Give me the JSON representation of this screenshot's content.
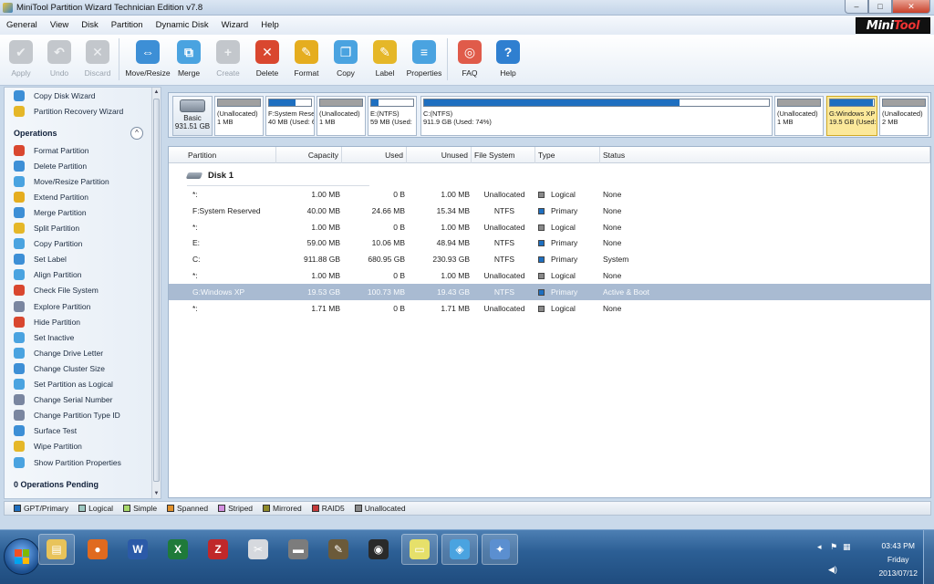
{
  "window": {
    "title": "MiniTool Partition Wizard Technician Edition v7.8",
    "logo_a": "Mini",
    "logo_b": "Tool",
    "min": "–",
    "max": "□",
    "close": "✕"
  },
  "menu": [
    "General",
    "View",
    "Disk",
    "Partition",
    "Dynamic Disk",
    "Wizard",
    "Help"
  ],
  "toolbar": [
    {
      "label": "Apply",
      "icon": "checkmark-icon",
      "enabled": false,
      "color": "#b4b9bf",
      "glyph": "✔"
    },
    {
      "label": "Undo",
      "icon": "undo-icon",
      "enabled": false,
      "color": "#b4b9bf",
      "glyph": "↶"
    },
    {
      "label": "Discard",
      "icon": "discard-icon",
      "enabled": false,
      "color": "#b4b9bf",
      "glyph": "✕"
    },
    {
      "label": "Move/Resize",
      "icon": "move-resize-icon",
      "enabled": true,
      "color": "#3d8fd6",
      "glyph": "⇔"
    },
    {
      "label": "Merge",
      "icon": "merge-icon",
      "enabled": true,
      "color": "#4aa3e0",
      "glyph": "⧉"
    },
    {
      "label": "Create",
      "icon": "create-icon",
      "enabled": false,
      "color": "#b4b9bf",
      "glyph": "+"
    },
    {
      "label": "Delete",
      "icon": "delete-icon",
      "enabled": true,
      "color": "#d9472f",
      "glyph": "✕"
    },
    {
      "label": "Format",
      "icon": "format-icon",
      "enabled": true,
      "color": "#e5ad1f",
      "glyph": "✎"
    },
    {
      "label": "Copy",
      "icon": "copy-icon",
      "enabled": true,
      "color": "#4aa3e0",
      "glyph": "❐"
    },
    {
      "label": "Label",
      "icon": "label-icon",
      "enabled": true,
      "color": "#e5b728",
      "glyph": "✎"
    },
    {
      "label": "Properties",
      "icon": "properties-icon",
      "enabled": true,
      "color": "#4aa3e0",
      "glyph": "≡"
    },
    {
      "label": "FAQ",
      "icon": "faq-lifebuoy-icon",
      "enabled": true,
      "color": "#e05b4a",
      "glyph": "◎"
    },
    {
      "label": "Help",
      "icon": "help-icon",
      "enabled": true,
      "color": "#2f7fd0",
      "glyph": "?"
    }
  ],
  "sidebar": {
    "wizards": [
      "Copy Disk Wizard",
      "Partition Recovery Wizard"
    ],
    "operations_title": "Operations",
    "collapse": "^",
    "operations": [
      "Format Partition",
      "Delete Partition",
      "Move/Resize Partition",
      "Extend Partition",
      "Merge Partition",
      "Split Partition",
      "Copy Partition",
      "Set Label",
      "Align Partition",
      "Check File System",
      "Explore Partition",
      "Hide Partition",
      "Set Inactive",
      "Change Drive Letter",
      "Change Cluster Size",
      "Set Partition as Logical",
      "Change Serial Number",
      "Change Partition Type ID",
      "Surface Test",
      "Wipe Partition",
      "Show Partition Properties"
    ],
    "pending": "0 Operations Pending"
  },
  "diskmap": {
    "disk_label": "Basic",
    "disk_size": "931.51 GB",
    "segments": [
      {
        "l1": "(Unallocated)",
        "l2": "1 MB",
        "used": 0,
        "unalloc": true
      },
      {
        "l1": "F:System Rese",
        "l2": "40 MB (Used: 6",
        "used": 0.62,
        "unalloc": false
      },
      {
        "l1": "(Unallocated)",
        "l2": "1 MB",
        "used": 0,
        "unalloc": true
      },
      {
        "l1": "E:(NTFS)",
        "l2": "59 MB (Used:",
        "used": 0.17,
        "unalloc": false
      },
      {
        "l1": "C:(NTFS)",
        "l2": "911.9 GB (Used: 74%)",
        "used": 0.74,
        "unalloc": false
      },
      {
        "l1": "(Unallocated)",
        "l2": "1 MB",
        "used": 0,
        "unalloc": true
      },
      {
        "l1": "G:Windows XP",
        "l2": "19.5 GB (Used:",
        "used": 0.01,
        "unalloc": false,
        "selected": true
      },
      {
        "l1": "(Unallocated)",
        "l2": "2 MB",
        "used": 0,
        "unalloc": true
      }
    ]
  },
  "table": {
    "headers": [
      "Partition",
      "Capacity",
      "Used",
      "Unused",
      "File System",
      "Type",
      "Status"
    ],
    "disk_title": "Disk 1",
    "rows": [
      {
        "partition": "*:",
        "capacity": "1.00 MB",
        "used": "0 B",
        "unused": "1.00 MB",
        "fs": "Unallocated",
        "type": "Logical",
        "status": "None",
        "type_color": "#8a8a8a"
      },
      {
        "partition": "F:System Reserved",
        "capacity": "40.00 MB",
        "used": "24.66 MB",
        "unused": "15.34 MB",
        "fs": "NTFS",
        "type": "Primary",
        "status": "None",
        "type_color": "#1e6fc0"
      },
      {
        "partition": "*:",
        "capacity": "1.00 MB",
        "used": "0 B",
        "unused": "1.00 MB",
        "fs": "Unallocated",
        "type": "Logical",
        "status": "None",
        "type_color": "#8a8a8a"
      },
      {
        "partition": "E:",
        "capacity": "59.00 MB",
        "used": "10.06 MB",
        "unused": "48.94 MB",
        "fs": "NTFS",
        "type": "Primary",
        "status": "None",
        "type_color": "#1e6fc0"
      },
      {
        "partition": "C:",
        "capacity": "911.88 GB",
        "used": "680.95 GB",
        "unused": "230.93 GB",
        "fs": "NTFS",
        "type": "Primary",
        "status": "System",
        "type_color": "#1e6fc0"
      },
      {
        "partition": "*:",
        "capacity": "1.00 MB",
        "used": "0 B",
        "unused": "1.00 MB",
        "fs": "Unallocated",
        "type": "Logical",
        "status": "None",
        "type_color": "#8a8a8a"
      },
      {
        "partition": "G:Windows XP",
        "capacity": "19.53 GB",
        "used": "100.73 MB",
        "unused": "19.43 GB",
        "fs": "NTFS",
        "type": "Primary",
        "status": "Active & Boot",
        "type_color": "#1e6fc0",
        "selected": true
      },
      {
        "partition": "*:",
        "capacity": "1.71 MB",
        "used": "0 B",
        "unused": "1.71 MB",
        "fs": "Unallocated",
        "type": "Logical",
        "status": "None",
        "type_color": "#8a8a8a"
      }
    ]
  },
  "legend": [
    {
      "label": "GPT/Primary",
      "color": "#1e6fc0"
    },
    {
      "label": "Logical",
      "color": "#9cc7c0"
    },
    {
      "label": "Simple",
      "color": "#a8d86b"
    },
    {
      "label": "Spanned",
      "color": "#e0902a"
    },
    {
      "label": "Striped",
      "color": "#d38fe0"
    },
    {
      "label": "Mirrored",
      "color": "#8f8a2a"
    },
    {
      "label": "RAID5",
      "color": "#c43a3a"
    },
    {
      "label": "Unallocated",
      "color": "#8a8a8a"
    }
  ],
  "taskbar": {
    "apps": [
      {
        "name": "explorer-icon",
        "color": "#e8c35a",
        "glyph": "▤",
        "open": true
      },
      {
        "name": "firefox-icon",
        "color": "#e06a1f",
        "glyph": "●",
        "open": false
      },
      {
        "name": "word-icon",
        "color": "#2b5aa8",
        "glyph": "W",
        "open": false
      },
      {
        "name": "excel-icon",
        "color": "#1f7a3a",
        "glyph": "X",
        "open": false
      },
      {
        "name": "filezilla-icon",
        "color": "#c0282a",
        "glyph": "Z",
        "open": false
      },
      {
        "name": "paint-icon",
        "color": "#d6d9de",
        "glyph": "✂",
        "open": false
      },
      {
        "name": "disk-tool-icon",
        "color": "#7c7c7c",
        "glyph": "▬",
        "open": false
      },
      {
        "name": "gimp-icon",
        "color": "#6b5a3a",
        "glyph": "✎",
        "open": false
      },
      {
        "name": "webcam-icon",
        "color": "#2a2a2a",
        "glyph": "◉",
        "open": false
      },
      {
        "name": "sticky-notes-icon",
        "color": "#e6e06a",
        "glyph": "▭",
        "open": true
      },
      {
        "name": "partition-wizard-icon",
        "color": "#4aa3e0",
        "glyph": "◈",
        "open": true
      },
      {
        "name": "paint-palette-icon",
        "color": "#5b8fd0",
        "glyph": "✦",
        "open": true
      }
    ],
    "tray_arrow": "◂",
    "time": "03:43 PM",
    "day": "Friday",
    "date": "2013/07/12"
  }
}
